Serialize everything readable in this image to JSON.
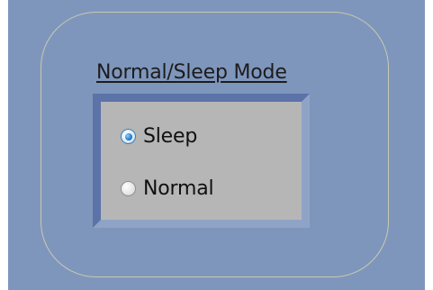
{
  "mode_group": {
    "title": "Normal/Sleep Mode",
    "options": [
      {
        "label": "Sleep",
        "selected": true
      },
      {
        "label": "Normal",
        "selected": false
      }
    ]
  },
  "colors": {
    "panel_background": "#7f96bc",
    "frame_border": "#c8c9b0",
    "radio_box_background": "#b6b6b6"
  }
}
